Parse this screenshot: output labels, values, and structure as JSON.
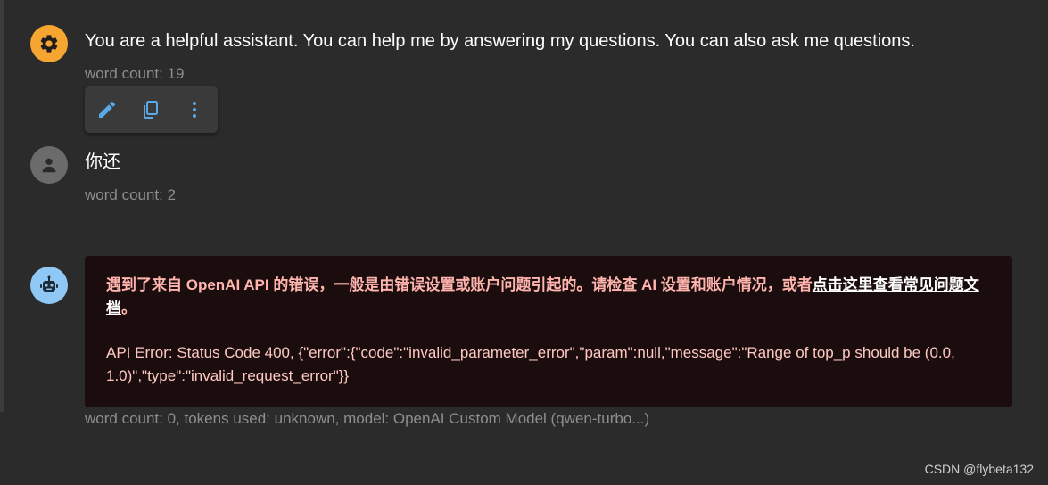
{
  "messages": {
    "system": {
      "avatar_icon": "gear-icon",
      "avatar_color": "#f6a530",
      "text": "You are a helpful assistant. You can help me by answering my questions. You can also ask me questions.",
      "meta": "word count: 19"
    },
    "user": {
      "avatar_icon": "person-icon",
      "avatar_color": "#6b6b6b",
      "text": "你还",
      "meta": "word count: 2"
    },
    "assistant": {
      "avatar_icon": "robot-icon",
      "avatar_color": "#8fc8f5",
      "error_headline": "遇到了来自 OpenAI API 的错误，一般是由错误设置或账户问题引起的。请检查 AI 设置和账户情况，或者",
      "error_link": "点击这里查看常见问题文档",
      "error_headline_end": "。",
      "error_detail": "API Error: Status Code 400, {\"error\":{\"code\":\"invalid_parameter_error\",\"param\":null,\"message\":\"Range of top_p should be (0.0, 1.0)\",\"type\":\"invalid_request_error\"}}",
      "meta": "word count: 0, tokens used: unknown, model: OpenAI Custom Model (qwen-turbo...)"
    }
  },
  "toolbar": {
    "icons": [
      "edit-icon",
      "copy-icon",
      "more-vertical-icon"
    ],
    "icon_color": "#5aa9e6"
  },
  "watermark": "CSDN @flybeta132",
  "colors": {
    "background": "#2b2b2b",
    "error_bg": "#1b0d0d",
    "error_text": "#ffb4ae"
  }
}
